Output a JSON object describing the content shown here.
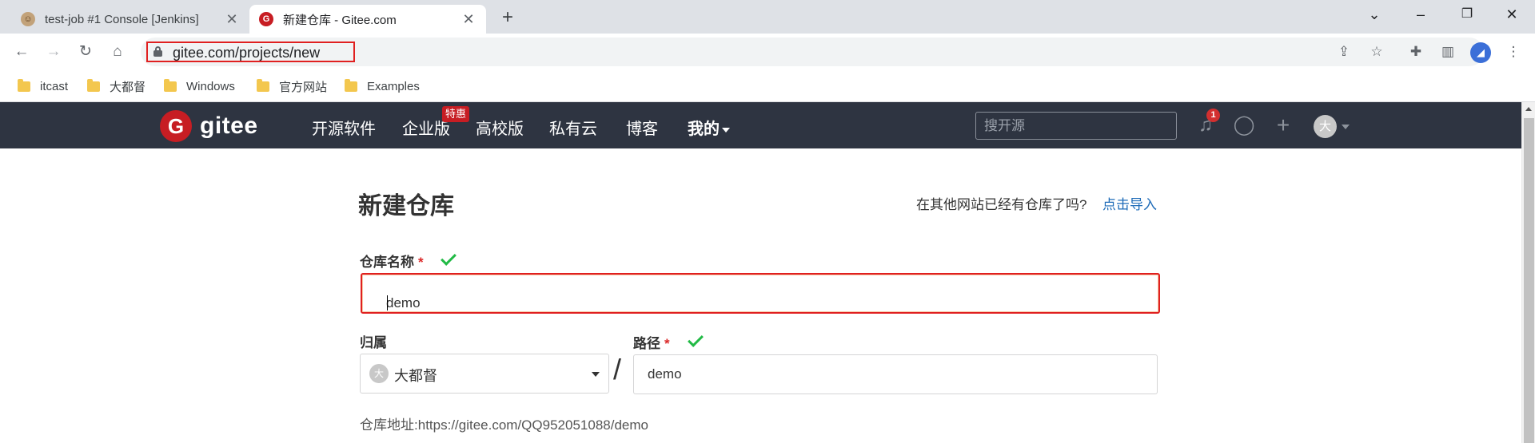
{
  "browser": {
    "tabs": [
      {
        "title": "test-job #1 Console [Jenkins]",
        "active": false
      },
      {
        "title": "新建仓库 - Gitee.com",
        "active": true
      }
    ],
    "new_tab_glyph": "+",
    "window_controls": {
      "minimize": "⌄",
      "restore": "–",
      "maximize": "❐",
      "close": "✕"
    },
    "address": "gitee.com/projects/new",
    "profile_initial": "◢",
    "bookmarks": [
      "itcast",
      "大都督",
      "Windows",
      "官方网站",
      "Examples"
    ]
  },
  "gitee": {
    "logo_mark": "G",
    "logo_text": "gitee",
    "nav": [
      "开源软件",
      "企业版",
      "高校版",
      "私有云",
      "博客",
      "我的"
    ],
    "enterprise_badge": "特惠",
    "search_placeholder": "搜开源",
    "notification_count": "1",
    "avatar_initial": "大"
  },
  "form": {
    "title": "新建仓库",
    "import_question": "在其他网站已经有仓库了吗?",
    "import_link": "点击导入",
    "repo_name_label": "仓库名称",
    "required_mark": "*",
    "repo_name_value": "demo",
    "owner_label": "归属",
    "owner_avatar": "大",
    "owner_value": "大都督",
    "path_separator": "/",
    "path_label": "路径",
    "path_value": "demo",
    "repo_address_label": "仓库地址:",
    "repo_address": "https://gitee.com/QQ952051088/demo"
  },
  "colors": {
    "gitee_red": "#c71d23",
    "header_bg": "#2e3441",
    "link_blue": "#1e6bb8",
    "check_green": "#21ba45",
    "highlight_red": "#e02020"
  }
}
